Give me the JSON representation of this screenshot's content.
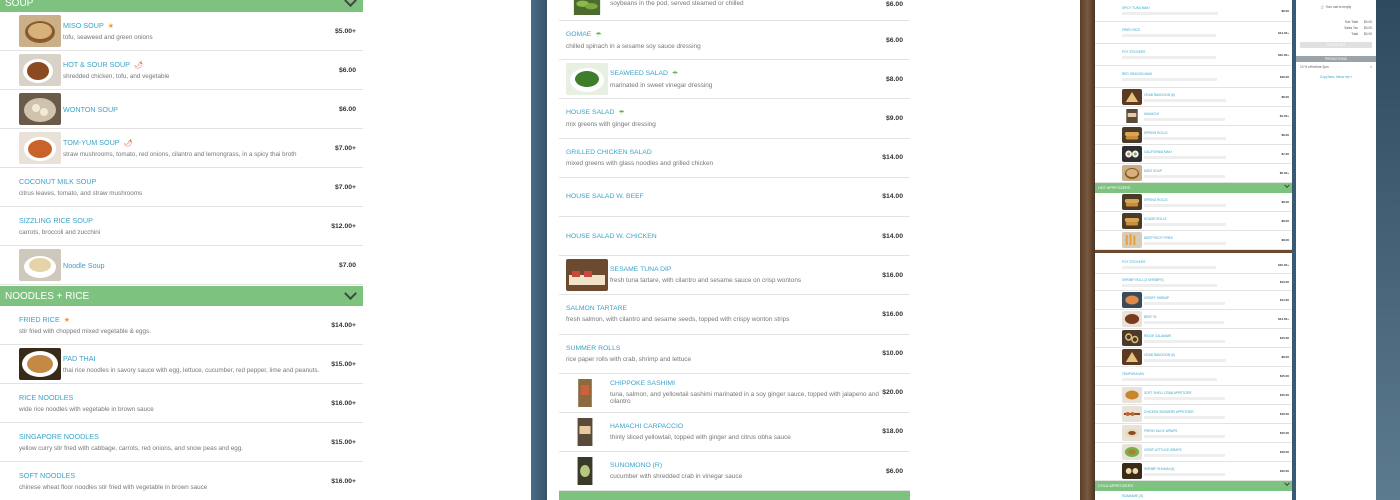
{
  "left_panel": {
    "soup_header": "SOUP",
    "soup_items": [
      {
        "name": "MISO SOUP",
        "desc": "tofu, seaweed and green onions",
        "price": "$5.00+",
        "tag": "star",
        "img": "miso"
      },
      {
        "name": "HOT & SOUR SOUP",
        "desc": "shredded chicken, tofu, and vegetable",
        "price": "$6.00",
        "tag": "chili",
        "img": "hotsour"
      },
      {
        "name": "WONTON SOUP",
        "desc": "",
        "price": "$6.00",
        "tag": "",
        "img": "wonton"
      },
      {
        "name": "TOM-YUM SOUP",
        "desc": "straw mushrooms, tomato, red onions, cilantro and lemongrass, in a spicy thai broth",
        "price": "$7.00+",
        "tag": "chili",
        "img": "tomyum"
      },
      {
        "name": "COCONUT MILK SOUP",
        "desc": "citrus leaves, tomato, and straw mushrooms",
        "price": "$7.00+",
        "tag": "",
        "img": ""
      },
      {
        "name": "SIZZLING RICE SOUP",
        "desc": "carrots, broccoli and zucchini",
        "price": "$12.00+",
        "tag": "",
        "img": ""
      },
      {
        "name": "Noodle Soup",
        "desc": "",
        "price": "$7.00",
        "tag": "",
        "img": "noodlesoup"
      }
    ],
    "noodles_header": "NOODLES + RICE",
    "noodle_items": [
      {
        "name": "FRIED RICE",
        "desc": "stir fried with chopped mixed vegetable & eggs.",
        "price": "$14.00+",
        "tag": "star",
        "img": ""
      },
      {
        "name": "PAD THAI",
        "desc": "thai rice noodles in savory sauce with egg, lettuce, cucumber, red pepper, lime and peanuts.",
        "price": "$15.00+",
        "tag": "",
        "img": "padthai"
      },
      {
        "name": "RICE NOODLES",
        "desc": "wide rice noodles with vegetable in brown sauce",
        "price": "$16.00+",
        "tag": "",
        "img": ""
      },
      {
        "name": "SINGAPORE NOODLES",
        "desc": "yellow curry stir fried with cabbage, carrots, red onions, and snow peas and egg.",
        "price": "$15.00+",
        "tag": "",
        "img": ""
      },
      {
        "name": "SOFT NOODLES",
        "desc": "chinese wheat floor noodles stir fried with vegetable in brown sauce",
        "price": "$16.00+",
        "tag": "",
        "img": ""
      }
    ]
  },
  "middle_panel": {
    "top_item": {
      "desc": "soybeans in the pod, served steamed or chilled",
      "price": "$6.00"
    },
    "items": [
      {
        "name": "GOMAE",
        "desc": "chilled spinach in a sesame soy sauce dressing",
        "price": "$6.00",
        "tag": "leaf",
        "img": ""
      },
      {
        "name": "SEAWEED SALAD",
        "desc": "marinated in sweet vinegar dressing",
        "price": "$8.00",
        "tag": "leaf",
        "img": "seaweed"
      },
      {
        "name": "HOUSE SALAD",
        "desc": "mix greens with ginger dressing",
        "price": "$9.00",
        "tag": "leaf",
        "img": ""
      },
      {
        "name": "GRILLED CHICKEN SALAD",
        "desc": "mixed greens with glass noodles and grilled chicken",
        "price": "$14.00",
        "tag": "",
        "img": ""
      },
      {
        "name": "HOUSE SALAD W. BEEF",
        "desc": "",
        "price": "$14.00",
        "tag": "",
        "img": ""
      },
      {
        "name": "HOUSE SALAD W. CHICKEN",
        "desc": "",
        "price": "$14.00",
        "tag": "",
        "img": ""
      },
      {
        "name": "SESAME TUNA DIP",
        "desc": "fresh tuna tartare, with cilantro and sesame sauce on crisp wontons",
        "price": "$16.00",
        "tag": "",
        "img": "tunadip"
      },
      {
        "name": "SALMON TARTARE",
        "desc": "fresh salmon, with cilantro and sesame seeds, topped with crispy wonton strips",
        "price": "$16.00",
        "tag": "",
        "img": ""
      },
      {
        "name": "SUMMER ROLLS",
        "desc": "rice paper rolls with crab, shrimp and lettuce",
        "price": "$10.00",
        "tag": "",
        "img": ""
      },
      {
        "name": "CHIPPOKE SASHIMI",
        "desc": "tuna, salmon, and yellowtail sashimi marinated in a soy ginger sauce, topped with jalapeno and cilantro",
        "price": "$20.00",
        "tag": "",
        "img": "chippoke"
      },
      {
        "name": "HAMACHI CARPACCIO",
        "desc": "thinly sliced yellowtail, topped with ginger and citrus obha sauce",
        "price": "$18.00",
        "tag": "",
        "img": "hamachi"
      },
      {
        "name": "SUNOMONO (R)",
        "desc": "cucumber with shredded crab in vinegar sauce",
        "price": "$6.00",
        "tag": "",
        "img": "sunomono"
      }
    ]
  },
  "right_panel": {
    "items_top": [
      {
        "name": "SPICY TUNA MAKI",
        "price": "$8.00",
        "img": "",
        "h": 22
      },
      {
        "name": "FRIED RICE",
        "price": "$14.00+",
        "img": "",
        "h": 22
      },
      {
        "name": "POT STICKERS",
        "price": "$10.00+",
        "img": "",
        "h": 22
      },
      {
        "name": "RED DRAGON MAKI",
        "price": "$16.00",
        "img": "",
        "h": 22
      },
      {
        "name": "CRAB RANGOON (6)",
        "price": "$8.00",
        "img": "rangoon",
        "h": 19
      },
      {
        "name": "HAMACHI",
        "price": "$4.00+",
        "img": "hamachi",
        "h": 19
      },
      {
        "name": "SPRING ROLLS",
        "price": "$8.00",
        "img": "springroll",
        "h": 19
      },
      {
        "name": "CALIFORNIA MAKI",
        "price": "$7.00",
        "img": "calmaki",
        "h": 19
      },
      {
        "name": "MISO SOUP",
        "price": "$5.00+",
        "img": "miso",
        "h": 19
      }
    ],
    "hot_header": "HOT APPETIZERS",
    "hot_items": [
      {
        "name": "SPRING ROLLS",
        "price": "$8.00",
        "img": "springroll",
        "h": 19
      },
      {
        "name": "HOUSE ROLLS",
        "price": "$8.00",
        "img": "springroll",
        "h": 19
      },
      {
        "name": "DEEP ROOT FRIES",
        "price": "$8.00",
        "img": "fries",
        "h": 19
      }
    ],
    "lower_items": [
      {
        "name": "POT STICKERS",
        "price": "$10.00+",
        "img": "",
        "h": 18
      },
      {
        "name": "SHRIMP ROLL (3 SHRIMPS)",
        "price": "$13.00",
        "img": "",
        "h": 17
      },
      {
        "name": "CRISPY SHRIMP",
        "price": "$14.00",
        "img": "shrimp",
        "h": 19
      },
      {
        "name": "BEEF 91",
        "price": "$14.00+",
        "img": "beef",
        "h": 19
      },
      {
        "name": "RIDGE CALAMARI",
        "price": "$15.00",
        "img": "calamari",
        "h": 19
      },
      {
        "name": "CRAB RANGOON (6)",
        "price": "$8.00",
        "img": "rangoon",
        "h": 19
      },
      {
        "name": "TEMPURA MIX",
        "price": "$15.00",
        "img": "",
        "h": 19
      },
      {
        "name": "SOFT SHELL CRAB APPETIZER",
        "price": "$15.00",
        "img": "crab",
        "h": 19
      },
      {
        "name": "CHICKEN SKEWERS APPETIZER",
        "price": "$16.00",
        "img": "skewer",
        "h": 19
      },
      {
        "name": "FRESH DUCK WRAPS",
        "price": "$15.00",
        "img": "duck",
        "h": 19
      },
      {
        "name": "CRISP LETTUCE WRAPS",
        "price": "$16.00",
        "img": "lettuce",
        "h": 19
      },
      {
        "name": "SHRIMP SHUMAI (6)",
        "price": "$10.00",
        "img": "shumai",
        "h": 19
      }
    ],
    "cold_header": "COLD APPETIZERS",
    "cold_first": "EDAMAME (S)"
  },
  "cart": {
    "empty_text": "Your cart is empty",
    "rows": [
      {
        "label": "Sub Total",
        "value": "$0.00"
      },
      {
        "label": "Sales Tax",
        "value": "$0.00"
      },
      {
        "label": "Total",
        "value": "$0.00"
      }
    ],
    "checkout": "CHECK OUT",
    "promotions": "PROMOTIONS",
    "promo": "10 % off before 2pm",
    "promo_link": "Copy item, follow me »"
  }
}
